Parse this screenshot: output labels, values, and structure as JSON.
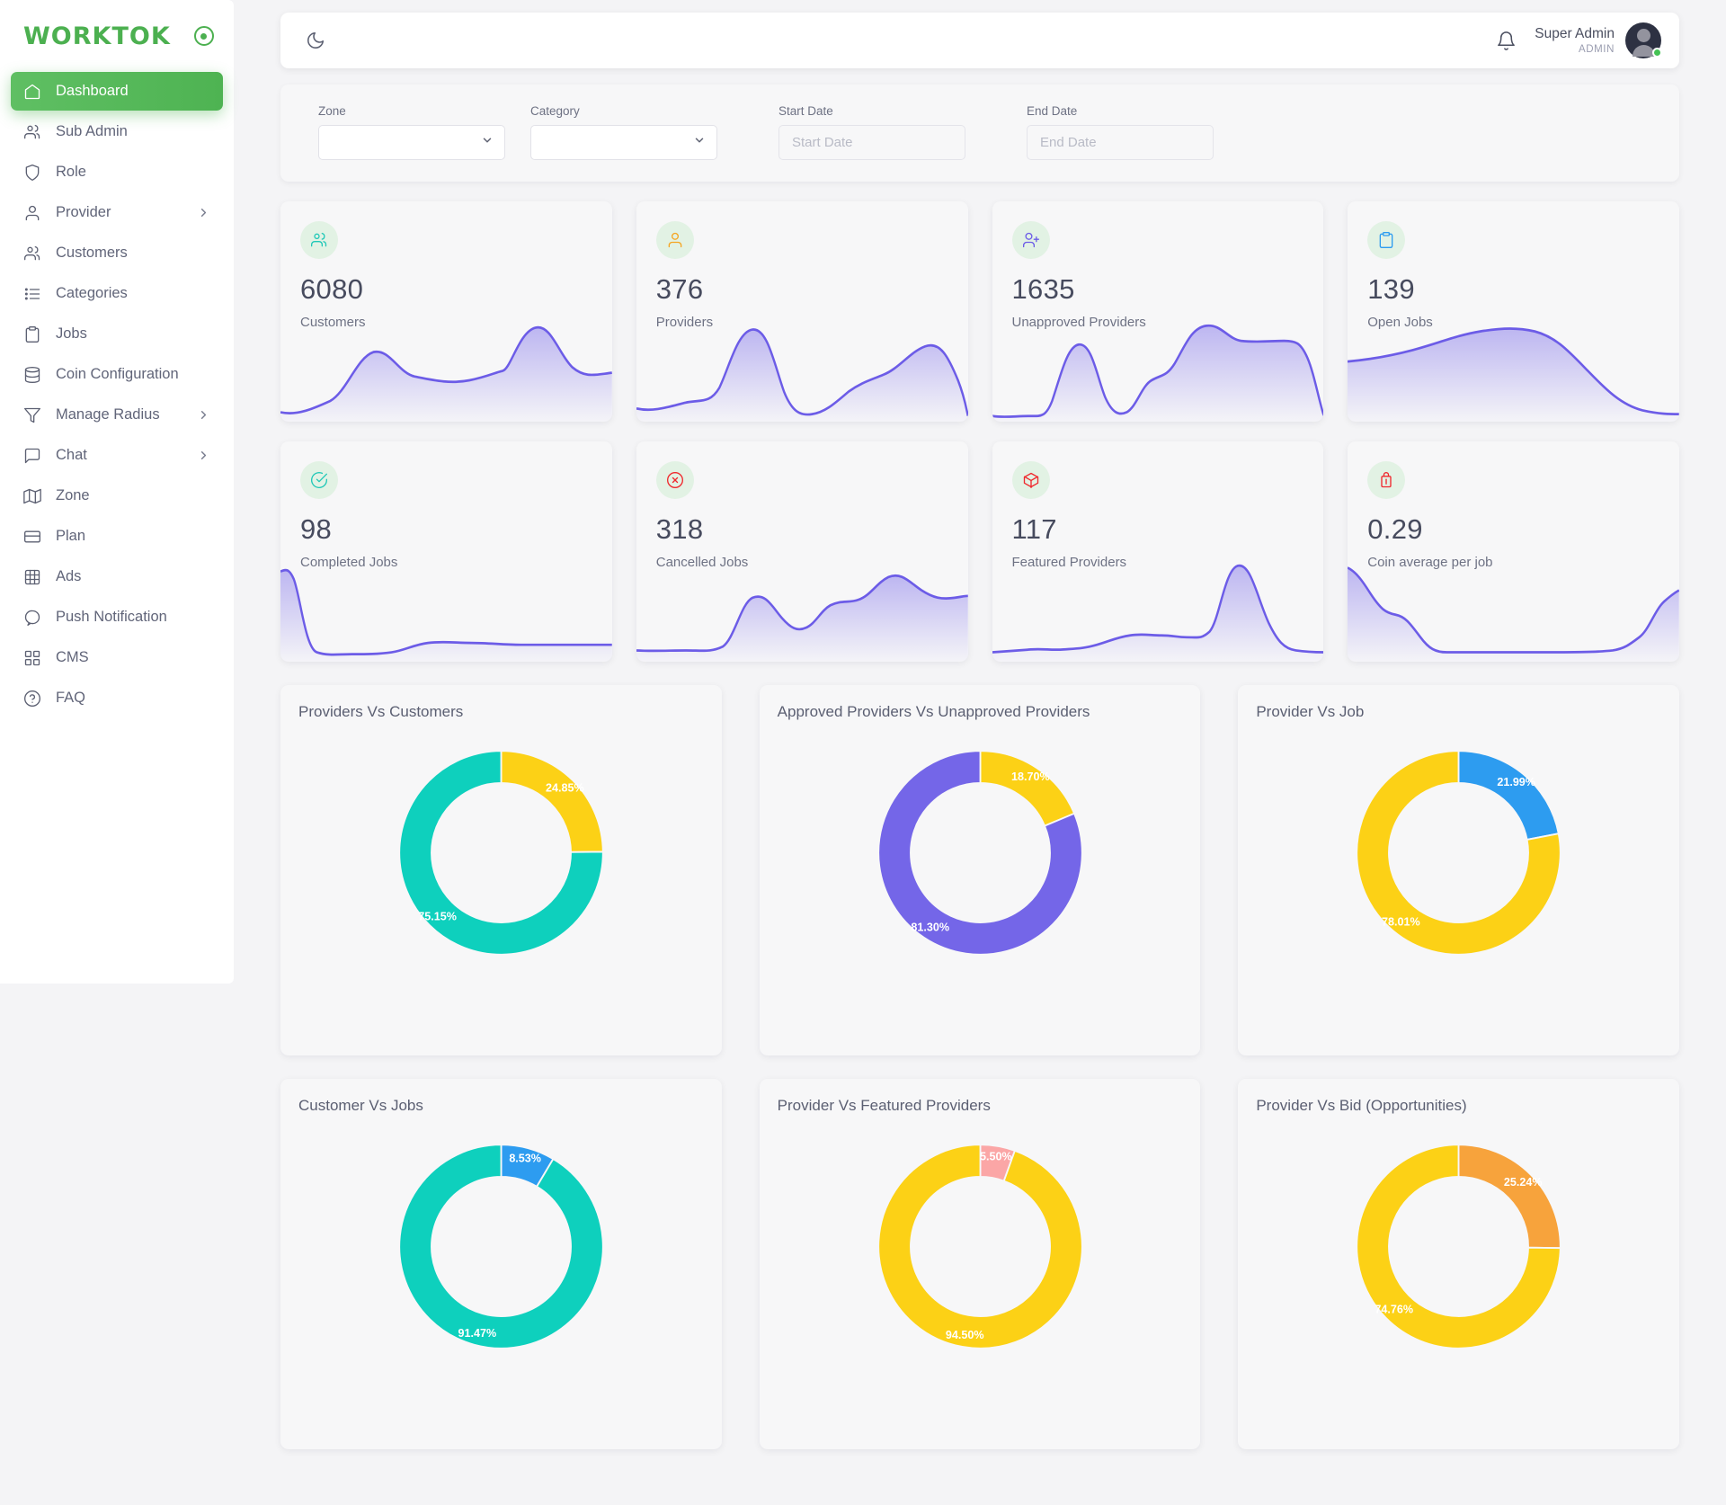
{
  "brand": {
    "name": "WORKTOK",
    "mark_icon": "target-icon"
  },
  "sidebar": {
    "items": [
      {
        "label": "Dashboard",
        "icon": "home-icon",
        "active": true,
        "expandable": false
      },
      {
        "label": "Sub Admin",
        "icon": "users-icon",
        "active": false,
        "expandable": false
      },
      {
        "label": "Role",
        "icon": "shield-icon",
        "active": false,
        "expandable": false
      },
      {
        "label": "Provider",
        "icon": "user-icon",
        "active": false,
        "expandable": true
      },
      {
        "label": "Customers",
        "icon": "users-icon",
        "active": false,
        "expandable": false
      },
      {
        "label": "Categories",
        "icon": "list-icon",
        "active": false,
        "expandable": false
      },
      {
        "label": "Jobs",
        "icon": "clipboard-icon",
        "active": false,
        "expandable": false
      },
      {
        "label": "Coin Configuration",
        "icon": "database-icon",
        "active": false,
        "expandable": false
      },
      {
        "label": "Manage Radius",
        "icon": "filter-icon",
        "active": false,
        "expandable": true
      },
      {
        "label": "Chat",
        "icon": "message-icon",
        "active": false,
        "expandable": true
      },
      {
        "label": "Zone",
        "icon": "map-icon",
        "active": false,
        "expandable": false
      },
      {
        "label": "Plan",
        "icon": "card-icon",
        "active": false,
        "expandable": false
      },
      {
        "label": "Ads",
        "icon": "film-icon",
        "active": false,
        "expandable": false
      },
      {
        "label": "Push Notification",
        "icon": "chat-bubble-icon",
        "active": false,
        "expandable": false
      },
      {
        "label": "CMS",
        "icon": "grid-icon",
        "active": false,
        "expandable": false
      },
      {
        "label": "FAQ",
        "icon": "help-circle-icon",
        "active": false,
        "expandable": false
      }
    ]
  },
  "topbar": {
    "theme_toggle_icon": "moon-icon",
    "notification_icon": "bell-icon",
    "user_name": "Super Admin",
    "user_role": "ADMIN",
    "avatar_icon": "avatar",
    "status_dot_color": "#45c254"
  },
  "filters": {
    "zone": {
      "label": "Zone",
      "value": "",
      "icon": "chevron-down-icon"
    },
    "category": {
      "label": "Category",
      "value": "",
      "icon": "chevron-down-icon"
    },
    "start_date": {
      "label": "Start Date",
      "value": "",
      "placeholder": "Start Date"
    },
    "end_date": {
      "label": "End Date",
      "value": "",
      "placeholder": "End Date"
    }
  },
  "stats": [
    {
      "value": "6080",
      "label": "Customers",
      "icon": "users-icon",
      "icon_color": "#21c8b7"
    },
    {
      "value": "376",
      "label": "Providers",
      "icon": "user-icon",
      "icon_color": "#f5a623"
    },
    {
      "value": "1635",
      "label": "Unapproved Providers",
      "icon": "user-plus-icon",
      "icon_color": "#6c5ce7"
    },
    {
      "value": "139",
      "label": "Open Jobs",
      "icon": "clipboard-icon",
      "icon_color": "#2d9cf0"
    },
    {
      "value": "98",
      "label": "Completed Jobs",
      "icon": "check-circle-icon",
      "icon_color": "#21c8b7"
    },
    {
      "value": "318",
      "label": "Cancelled Jobs",
      "icon": "x-circle-icon",
      "icon_color": "#f0282d"
    },
    {
      "value": "117",
      "label": "Featured Providers",
      "icon": "box-icon",
      "icon_color": "#f0282d"
    },
    {
      "value": "0.29",
      "label": "Coin average per job",
      "icon": "coin-icon",
      "icon_color": "#f0282d"
    }
  ],
  "chart_data": [
    {
      "type": "pie",
      "title": "Providers Vs Customers",
      "labels": [
        "Providers",
        "Customers"
      ],
      "values": [
        24.85,
        75.15
      ],
      "display_values": [
        "24.85%",
        "75.15%"
      ],
      "colors": [
        "#fcd116",
        "#0ed0bd"
      ],
      "donut": true,
      "legend": "none"
    },
    {
      "type": "pie",
      "title": "Approved Providers Vs Unapproved Providers",
      "labels": [
        "Approved Providers",
        "Unapproved Providers"
      ],
      "values": [
        18.7,
        81.3
      ],
      "display_values": [
        "18.70%",
        "81.30%"
      ],
      "colors": [
        "#fcd116",
        "#7466e8"
      ],
      "donut": true,
      "legend": "none"
    },
    {
      "type": "pie",
      "title": "Provider Vs Job",
      "labels": [
        "Provider",
        "Job"
      ],
      "values": [
        21.99,
        78.01
      ],
      "display_values": [
        "21.99%",
        "78.01%"
      ],
      "colors": [
        "#2d9cf0",
        "#fcd116"
      ],
      "donut": true,
      "legend": "none"
    },
    {
      "type": "pie",
      "title": "Customer Vs Jobs",
      "labels": [
        "Jobs",
        "Customer"
      ],
      "values": [
        8.53,
        91.47
      ],
      "display_values": [
        "8.53%",
        "91.47%"
      ],
      "colors": [
        "#2d9cf0",
        "#0ed0bd"
      ],
      "donut": true,
      "legend": "none"
    },
    {
      "type": "pie",
      "title": "Provider Vs Featured Providers",
      "labels": [
        "Featured Providers",
        "Provider"
      ],
      "values": [
        5.5,
        94.5
      ],
      "display_values": [
        "5.50%",
        "94.50%"
      ],
      "colors": [
        "#fba6a6",
        "#fcd116"
      ],
      "donut": true,
      "legend": "none"
    },
    {
      "type": "pie",
      "title": "Provider Vs Bid (Opportunities)",
      "labels": [
        "Bid",
        "Provider"
      ],
      "values": [
        25.24,
        74.76
      ],
      "display_values": [
        "25.24%",
        "74.76%"
      ],
      "colors": [
        "#f7a33c",
        "#fcd116"
      ],
      "donut": true,
      "legend": "none"
    }
  ],
  "theme": {
    "accent_green": "#4cb050",
    "sparkline_stroke": "#6c5ce7",
    "page_bg": "#f4f4f6",
    "card_bg": "#f7f7f8"
  }
}
